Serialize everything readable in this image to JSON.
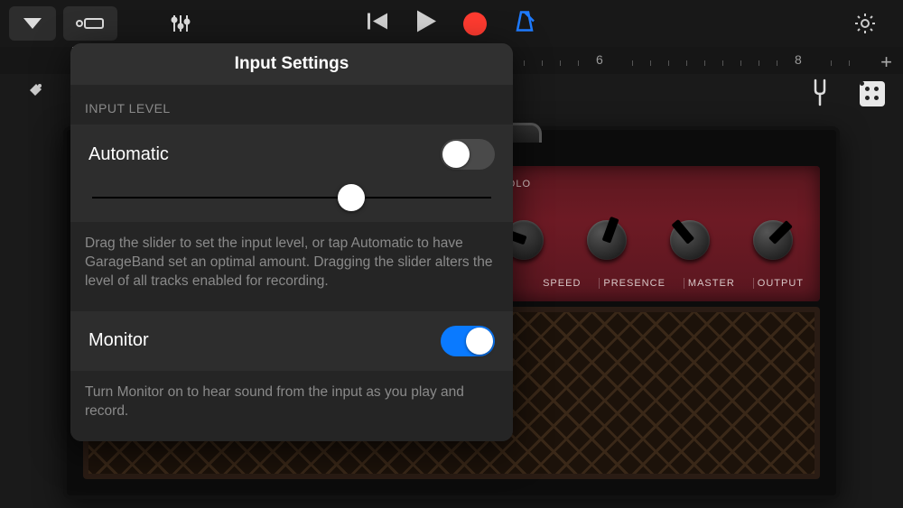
{
  "popover": {
    "title": "Input Settings",
    "section_label": "INPUT LEVEL",
    "automatic_label": "Automatic",
    "automatic_on": false,
    "level_slider_percent": 65,
    "level_caption": "Drag the slider to set the input level, or tap Automatic to have GarageBand set an optimal amount. Dragging the slider alters the level of all tracks enabled for recording.",
    "monitor_label": "Monitor",
    "monitor_on": true,
    "monitor_caption": "Turn Monitor on to hear sound from the input as you play and record."
  },
  "ruler": {
    "marks": [
      "6",
      "8"
    ]
  },
  "amp": {
    "section": "EMOLO",
    "knob_labels": [
      "SPEED",
      "PRESENCE",
      "MASTER",
      "OUTPUT"
    ]
  }
}
